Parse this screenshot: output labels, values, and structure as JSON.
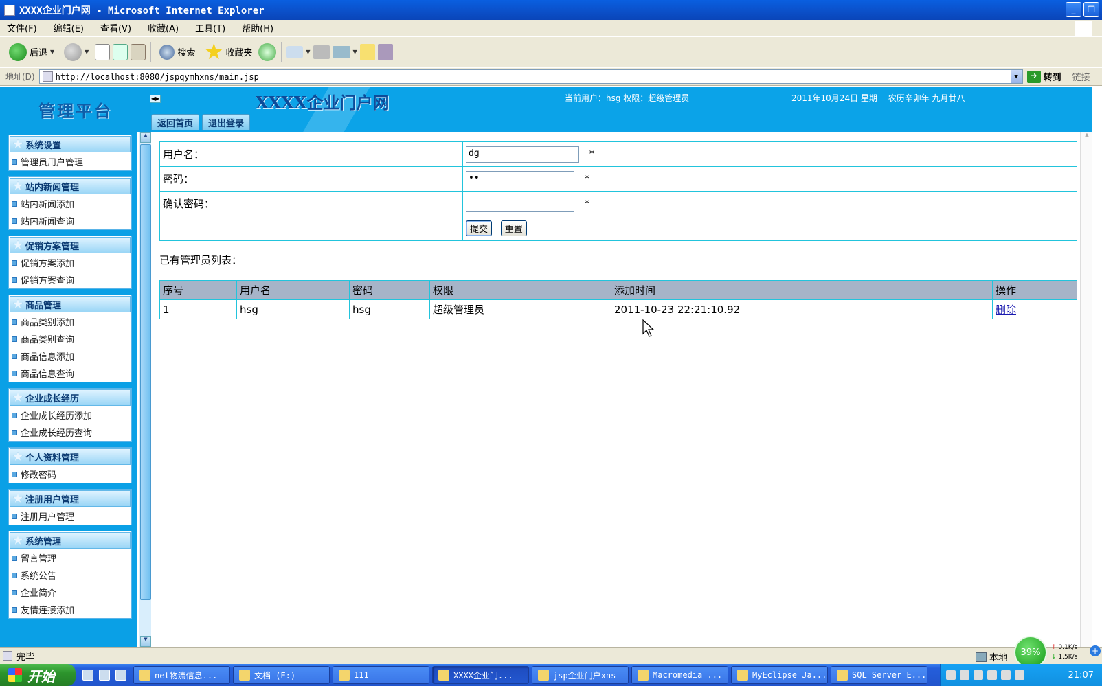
{
  "window": {
    "title": "XXXX企业门户网 - Microsoft Internet Explorer"
  },
  "menu": [
    "文件(F)",
    "编辑(E)",
    "查看(V)",
    "收藏(A)",
    "工具(T)",
    "帮助(H)"
  ],
  "toolbar": {
    "back": "后退",
    "search": "搜索",
    "favorites": "收藏夹"
  },
  "address": {
    "label": "地址(D)",
    "url": "http://localhost:8080/jspqymhxns/main.jsp",
    "go": "转到",
    "links": "链接"
  },
  "header": {
    "logo": "管理平台",
    "site_title": "XXXX企业门户网",
    "current_user": "当前用户：hsg 权限：超级管理员",
    "date": "2011年10月24日 星期一 农历辛卯年 九月廿八",
    "tabs": [
      "返回首页",
      "退出登录"
    ]
  },
  "sidebar": {
    "groups": [
      {
        "title": "系统设置",
        "items": [
          "管理员用户管理"
        ]
      },
      {
        "title": "站内新闻管理",
        "items": [
          "站内新闻添加",
          "站内新闻查询"
        ]
      },
      {
        "title": "促销方案管理",
        "items": [
          "促销方案添加",
          "促销方案查询"
        ]
      },
      {
        "title": "商品管理",
        "items": [
          "商品类别添加",
          "商品类别查询",
          "商品信息添加",
          "商品信息查询"
        ]
      },
      {
        "title": "企业成长经历",
        "items": [
          "企业成长经历添加",
          "企业成长经历查询"
        ]
      },
      {
        "title": "个人资料管理",
        "items": [
          "修改密码"
        ]
      },
      {
        "title": "注册用户管理",
        "items": [
          "注册用户管理"
        ]
      },
      {
        "title": "系统管理",
        "items": [
          "留言管理",
          "系统公告",
          "企业简介",
          "友情连接添加"
        ]
      }
    ]
  },
  "form": {
    "username_label": "用户名：",
    "username_value": "dg",
    "password_label": "密码：",
    "password_value": "••",
    "confirm_label": "确认密码：",
    "confirm_value": "",
    "required": "*",
    "submit": "提交",
    "reset": "重置"
  },
  "list": {
    "title": "已有管理员列表：",
    "columns": [
      "序号",
      "用户名",
      "密码",
      "权限",
      "添加时间",
      "操作"
    ],
    "rows": [
      {
        "no": "1",
        "username": "hsg",
        "password": "hsg",
        "role": "超级管理员",
        "added": "2011-10-23 22:21:10.92",
        "action": "删除"
      }
    ]
  },
  "status": {
    "text": "完毕",
    "zone": "本地",
    "net_percent": "39%",
    "up": "0.1K/s",
    "down": "1.5K/s"
  },
  "taskbar": {
    "start": "开始",
    "tasks": [
      "net物流信息...",
      "文档 (E:)",
      "111",
      "XXXX企业门...",
      "jsp企业门户xns",
      "Macromedia ...",
      "MyEclipse Ja...",
      "SQL Server E..."
    ],
    "active_index": 3,
    "clock": "21:07"
  }
}
